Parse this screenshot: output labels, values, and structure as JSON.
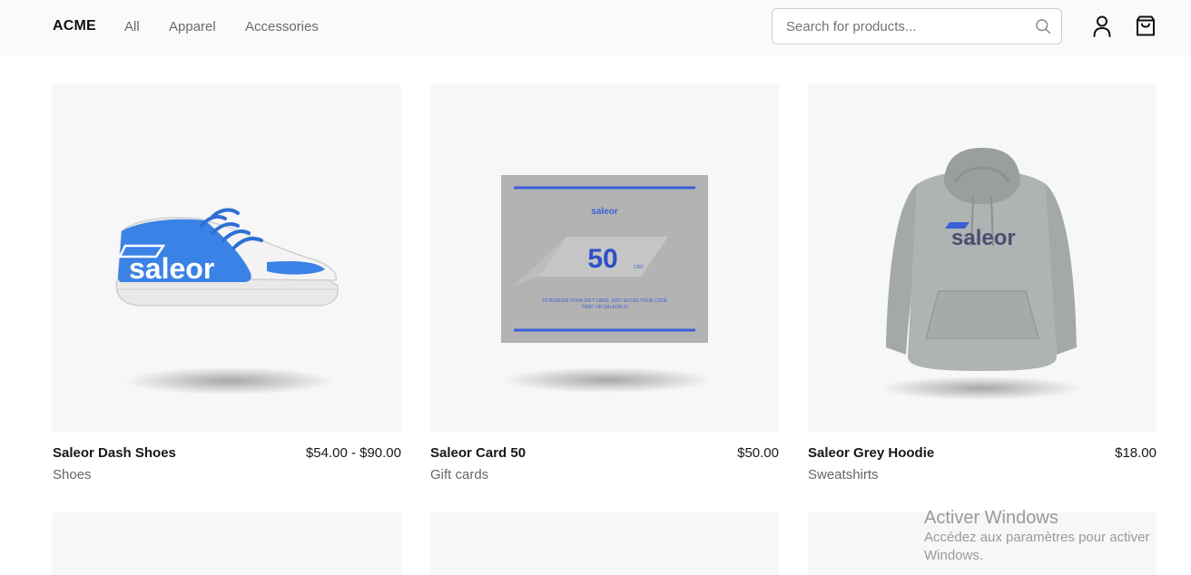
{
  "header": {
    "brand": "ACME",
    "nav": [
      {
        "label": "All"
      },
      {
        "label": "Apparel"
      },
      {
        "label": "Accessories"
      }
    ],
    "search_placeholder": "Search for products...",
    "icons": {
      "search": "search-icon",
      "user": "user-icon",
      "cart": "shopping-bag-icon"
    }
  },
  "products": [
    {
      "name": "Saleor Dash Shoes",
      "price": "$54.00 - $90.00",
      "category": "Shoes",
      "image_text": "saleor"
    },
    {
      "name": "Saleor Card 50",
      "price": "$50.00",
      "category": "Gift cards",
      "image_text": {
        "brand": "saleor",
        "amount": "50",
        "unit": "CRD",
        "line1": "TO REDEEM YOUR GIFT CARD, JUST ENTER YOUR CODE",
        "line2": "\"0000\" ON SALEOR.IO"
      }
    },
    {
      "name": "Saleor Grey Hoodie",
      "price": "$18.00",
      "category": "Sweatshirts",
      "image_text": "saleor"
    }
  ],
  "watermark": {
    "title": "Activer Windows",
    "subtitle": "Accédez aux paramètres pour activer Windows."
  },
  "colors": {
    "accent_blue": "#3b82e6",
    "page_bg": "#ffffff",
    "header_bg": "#fafafa",
    "tile_bg": "#f7f7f7"
  }
}
